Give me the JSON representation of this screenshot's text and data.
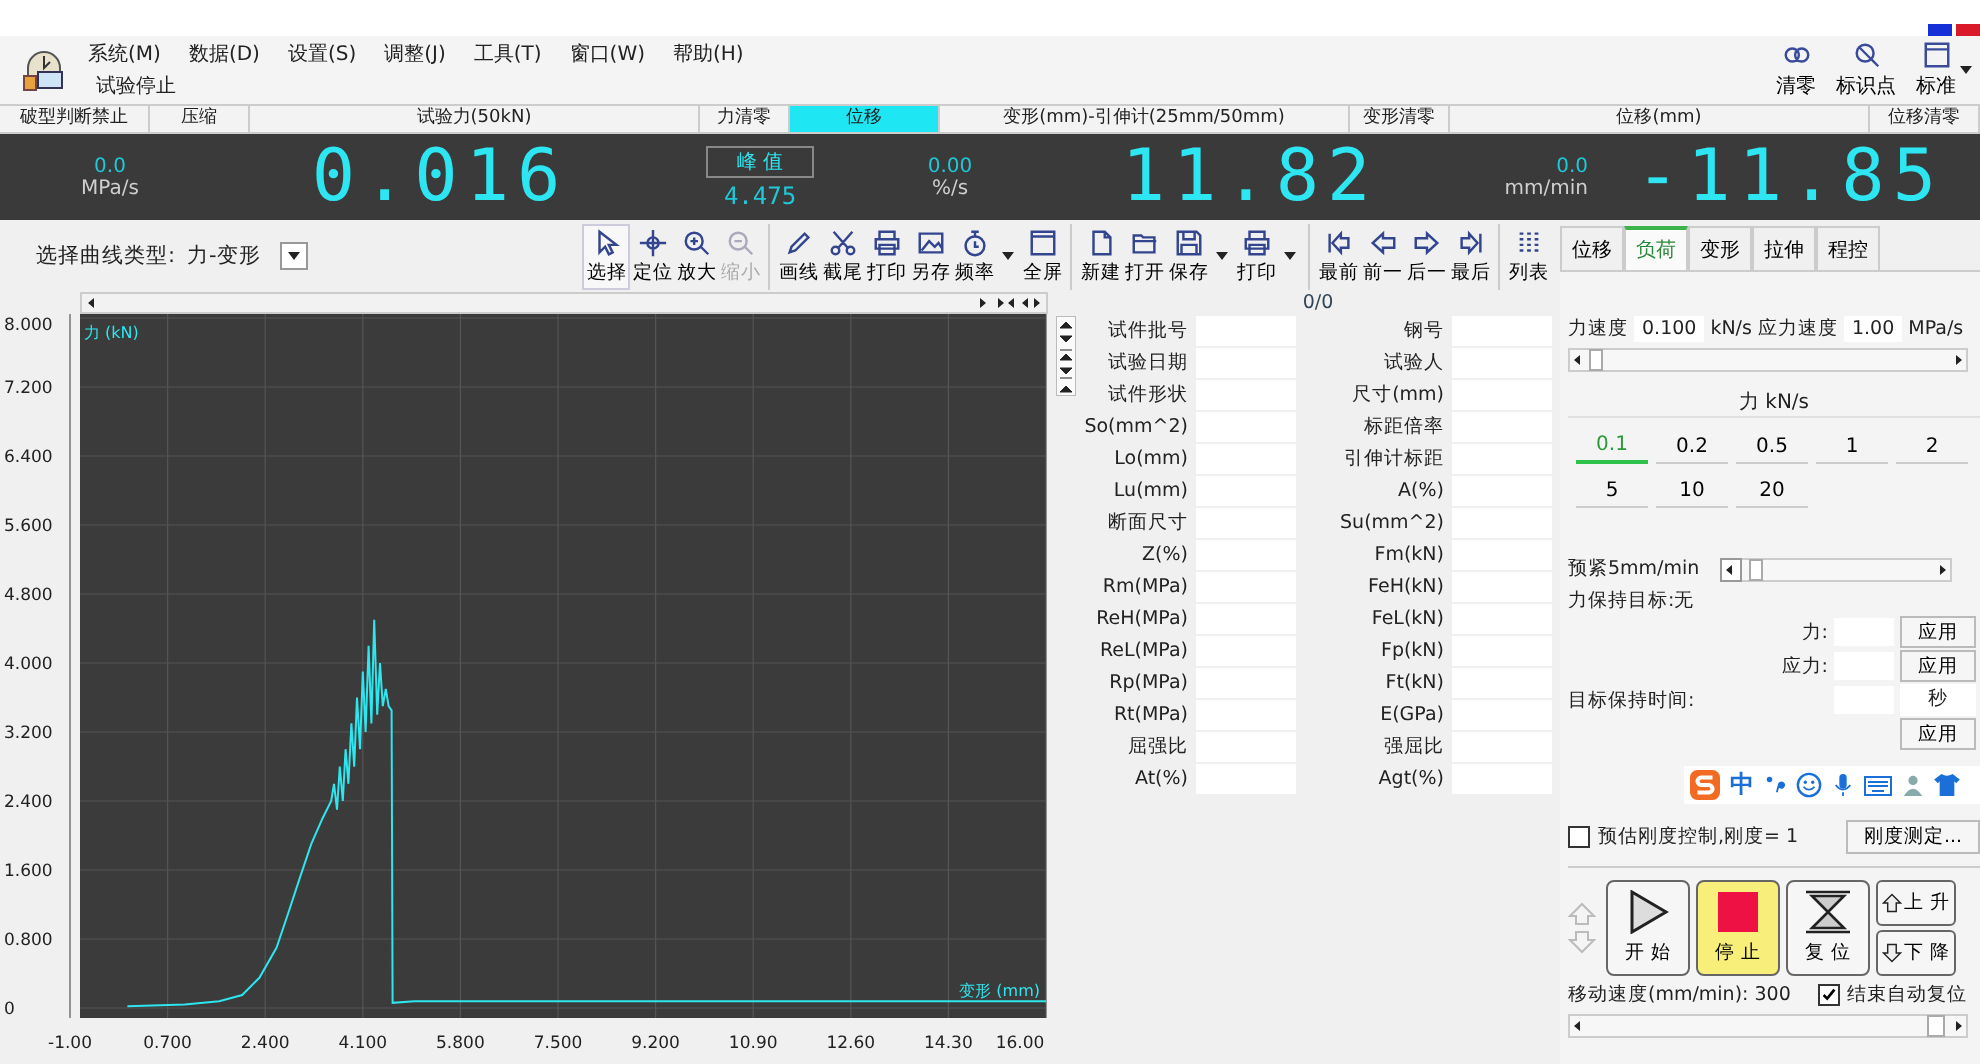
{
  "menu": {
    "items": [
      "系统(M)",
      "数据(D)",
      "设置(S)",
      "调整(J)",
      "工具(T)",
      "窗口(W)",
      "帮助(H)"
    ],
    "status": "试验停止"
  },
  "quick_tools": [
    {
      "kind": "clear",
      "label": "清零",
      "dropdown": false
    },
    {
      "kind": "mark",
      "label": "标识点",
      "dropdown": false
    },
    {
      "kind": "standard",
      "label": "标准",
      "dropdown": true
    }
  ],
  "channel_bar": [
    {
      "label": "破型判断禁止",
      "selected": false
    },
    {
      "label": "压缩",
      "selected": false
    },
    {
      "label": "试验力(50kN)",
      "selected": false
    },
    {
      "label": "力清零",
      "selected": false
    },
    {
      "label": "位移",
      "selected": true
    },
    {
      "label": "变形(mm)-引伸计(25mm/50mm)",
      "selected": false
    },
    {
      "label": "变形清零",
      "selected": false
    },
    {
      "label": "位移(mm)",
      "selected": false
    },
    {
      "label": "位移清零",
      "selected": false
    }
  ],
  "display": {
    "stress_rate": "0.0",
    "stress_rate_unit": "MPa/s",
    "force": "0.016",
    "peak_label": "峰 值",
    "peak": "4.475",
    "strain_rate": "0.00",
    "strain_rate_unit": "%/s",
    "deformation": "11.82",
    "speed": "0.0",
    "speed_unit": "mm/min",
    "displacement": "-11.85"
  },
  "curve_select": {
    "label": "选择曲线类型:",
    "value": "力-变形"
  },
  "toolbar": [
    {
      "tools": [
        {
          "kind": "select",
          "label": "选择",
          "disabled": false,
          "dropdown": false
        },
        {
          "kind": "locate",
          "label": "定位",
          "disabled": false,
          "dropdown": false
        },
        {
          "kind": "zoom_in",
          "label": "放大",
          "disabled": false,
          "dropdown": false
        },
        {
          "kind": "zoom_out",
          "label": "缩小",
          "disabled": true,
          "dropdown": false
        }
      ]
    },
    {
      "tools": [
        {
          "kind": "draw_line",
          "label": "画线",
          "disabled": false,
          "dropdown": false
        },
        {
          "kind": "truncate",
          "label": "截尾",
          "disabled": false,
          "dropdown": false
        },
        {
          "kind": "print",
          "label": "打印",
          "disabled": false,
          "dropdown": false
        },
        {
          "kind": "save_as",
          "label": "另存",
          "disabled": false,
          "dropdown": false
        },
        {
          "kind": "frequency",
          "label": "频率",
          "disabled": false,
          "dropdown": true
        },
        {
          "kind": "fullscreen",
          "label": "全屏",
          "disabled": false,
          "dropdown": false
        }
      ]
    },
    {
      "tools": [
        {
          "kind": "new",
          "label": "新建",
          "disabled": false,
          "dropdown": false
        },
        {
          "kind": "open",
          "label": "打开",
          "disabled": false,
          "dropdown": false
        },
        {
          "kind": "save",
          "label": "保存",
          "disabled": false,
          "dropdown": true
        },
        {
          "kind": "print",
          "label": "打印",
          "disabled": false,
          "dropdown": true
        }
      ]
    },
    {
      "tools": [
        {
          "kind": "first",
          "label": "最前",
          "disabled": false,
          "dropdown": false
        },
        {
          "kind": "prev",
          "label": "前一",
          "disabled": false,
          "dropdown": false
        },
        {
          "kind": "next",
          "label": "后一",
          "disabled": false,
          "dropdown": false
        },
        {
          "kind": "last",
          "label": "最后",
          "disabled": false,
          "dropdown": false
        }
      ]
    },
    {
      "tools": [
        {
          "kind": "list",
          "label": "列表",
          "disabled": false,
          "dropdown": false
        }
      ]
    }
  ],
  "record_counter": "0/0",
  "chart": {
    "chart_data": {
      "type": "line",
      "grid": true,
      "ylabel": "力 (kN)",
      "xlabel": "变形 (mm)",
      "x": [
        0,
        1,
        1.6,
        2.0,
        2.3,
        2.6,
        2.8,
        3.0,
        3.2,
        3.4,
        3.55,
        3.6,
        3.65,
        3.7,
        3.75,
        3.8,
        3.85,
        3.9,
        3.95,
        4.0,
        4.05,
        4.1,
        4.15,
        4.2,
        4.25,
        4.3,
        4.35,
        4.4,
        4.45,
        4.5,
        4.55,
        4.6,
        4.62,
        5,
        8,
        12,
        16
      ],
      "series": [
        {
          "color": "#2ee6ee",
          "values": [
            0.02,
            0.04,
            0.08,
            0.15,
            0.35,
            0.7,
            1.1,
            1.5,
            1.9,
            2.2,
            2.4,
            2.6,
            2.3,
            2.8,
            2.4,
            3.0,
            2.6,
            3.3,
            2.8,
            3.6,
            3.0,
            3.9,
            3.2,
            4.2,
            3.3,
            4.5,
            3.4,
            4.0,
            3.5,
            3.7,
            3.5,
            3.45,
            0.06,
            0.08,
            0.08,
            0.08,
            0.08
          ]
        }
      ],
      "xlim": [
        -1,
        16
      ],
      "ylim": [
        0,
        8
      ],
      "xticks": [
        {
          "value": -1,
          "label": "-1.00"
        },
        {
          "value": 0.7,
          "label": "0.700"
        },
        {
          "value": 2.4,
          "label": "2.400"
        },
        {
          "value": 4.1,
          "label": "4.100"
        },
        {
          "value": 5.8,
          "label": "5.800"
        },
        {
          "value": 7.5,
          "label": "7.500"
        },
        {
          "value": 9.2,
          "label": "9.200"
        },
        {
          "value": 10.9,
          "label": "10.90"
        },
        {
          "value": 12.6,
          "label": "12.60"
        },
        {
          "value": 14.3,
          "label": "14.30"
        },
        {
          "value": 16,
          "label": "16.00"
        }
      ],
      "yticks": [
        {
          "value": 0,
          "label": "0"
        },
        {
          "value": 0.8,
          "label": "0.800"
        },
        {
          "value": 1.6,
          "label": "1.600"
        },
        {
          "value": 2.4,
          "label": "2.400"
        },
        {
          "value": 3.2,
          "label": "3.200"
        },
        {
          "value": 4,
          "label": "4.000"
        },
        {
          "value": 4.8,
          "label": "4.800"
        },
        {
          "value": 5.6,
          "label": "5.600"
        },
        {
          "value": 6.4,
          "label": "6.400"
        },
        {
          "value": 7.2,
          "label": "7.200"
        },
        {
          "value": 8,
          "label": "8.000"
        }
      ]
    }
  },
  "results": [
    {
      "left": "试件批号",
      "right": "钢号"
    },
    {
      "left": "试验日期",
      "right": "试验人"
    },
    {
      "left": "试件形状",
      "right": "尺寸(mm)"
    },
    {
      "left": "So(mm^2)",
      "right": "标距倍率"
    },
    {
      "left": "Lo(mm)",
      "right": "引伸计标距"
    },
    {
      "left": "Lu(mm)",
      "right": "A(%)"
    },
    {
      "left": "断面尺寸",
      "right": "Su(mm^2)"
    },
    {
      "left": "Z(%)",
      "right": "Fm(kN)"
    },
    {
      "left": "Rm(MPa)",
      "right": "FeH(kN)"
    },
    {
      "left": "ReH(MPa)",
      "right": "FeL(kN)"
    },
    {
      "left": "ReL(MPa)",
      "right": "Fp(kN)"
    },
    {
      "left": "Rp(MPa)",
      "right": "Ft(kN)"
    },
    {
      "left": "Rt(MPa)",
      "right": "E(GPa)"
    },
    {
      "left": "屈强比",
      "right": "强屈比"
    },
    {
      "left": "At(%)",
      "right": "Agt(%)"
    }
  ],
  "tabs": [
    {
      "label": "位移",
      "selected": false
    },
    {
      "label": "负荷",
      "selected": true
    },
    {
      "label": "变形",
      "selected": false
    },
    {
      "label": "拉伸",
      "selected": false
    },
    {
      "label": "程控",
      "selected": false
    }
  ],
  "load_panel": {
    "force_rate": {
      "label": "力速度",
      "value": "0.100",
      "unit": "kN/s"
    },
    "stress_rate": {
      "label": "应力速度",
      "value": "1.00",
      "unit": "MPa/s"
    },
    "preset_title": "力 kN/s",
    "presets": [
      {
        "label": "0.1",
        "selected": true
      },
      {
        "label": "0.2",
        "selected": false
      },
      {
        "label": "0.5",
        "selected": false
      },
      {
        "label": "1",
        "selected": false
      },
      {
        "label": "2",
        "selected": false
      },
      {
        "label": "5",
        "selected": false
      },
      {
        "label": "10",
        "selected": false
      },
      {
        "label": "20",
        "selected": false
      }
    ],
    "preload": "预紧5mm/min",
    "hold_target": "力保持目标:无",
    "hold_rows": [
      {
        "label": "力:",
        "button": "应用"
      },
      {
        "label": "应力:",
        "button": "应用"
      }
    ],
    "hold_time": {
      "label": "目标保持时间:",
      "unit": "秒",
      "button": "应用"
    }
  },
  "ime_bar": {
    "label": "中"
  },
  "stiffness": {
    "label": "预估刚度控制,刚度= 1",
    "checked": false,
    "button": "刚度测定..."
  },
  "controls": [
    {
      "kind": "start",
      "label": "开 始",
      "active": false
    },
    {
      "kind": "stop",
      "label": "停 止",
      "active": true
    },
    {
      "kind": "reset",
      "label": "复 位",
      "active": false
    }
  ],
  "jog": [
    {
      "kind": "up",
      "label": "上 升"
    },
    {
      "kind": "down",
      "label": "下 降"
    }
  ],
  "move_speed": "移动速度(mm/min): 300",
  "auto_reset": {
    "label": "结束自动复位",
    "checked": true
  }
}
